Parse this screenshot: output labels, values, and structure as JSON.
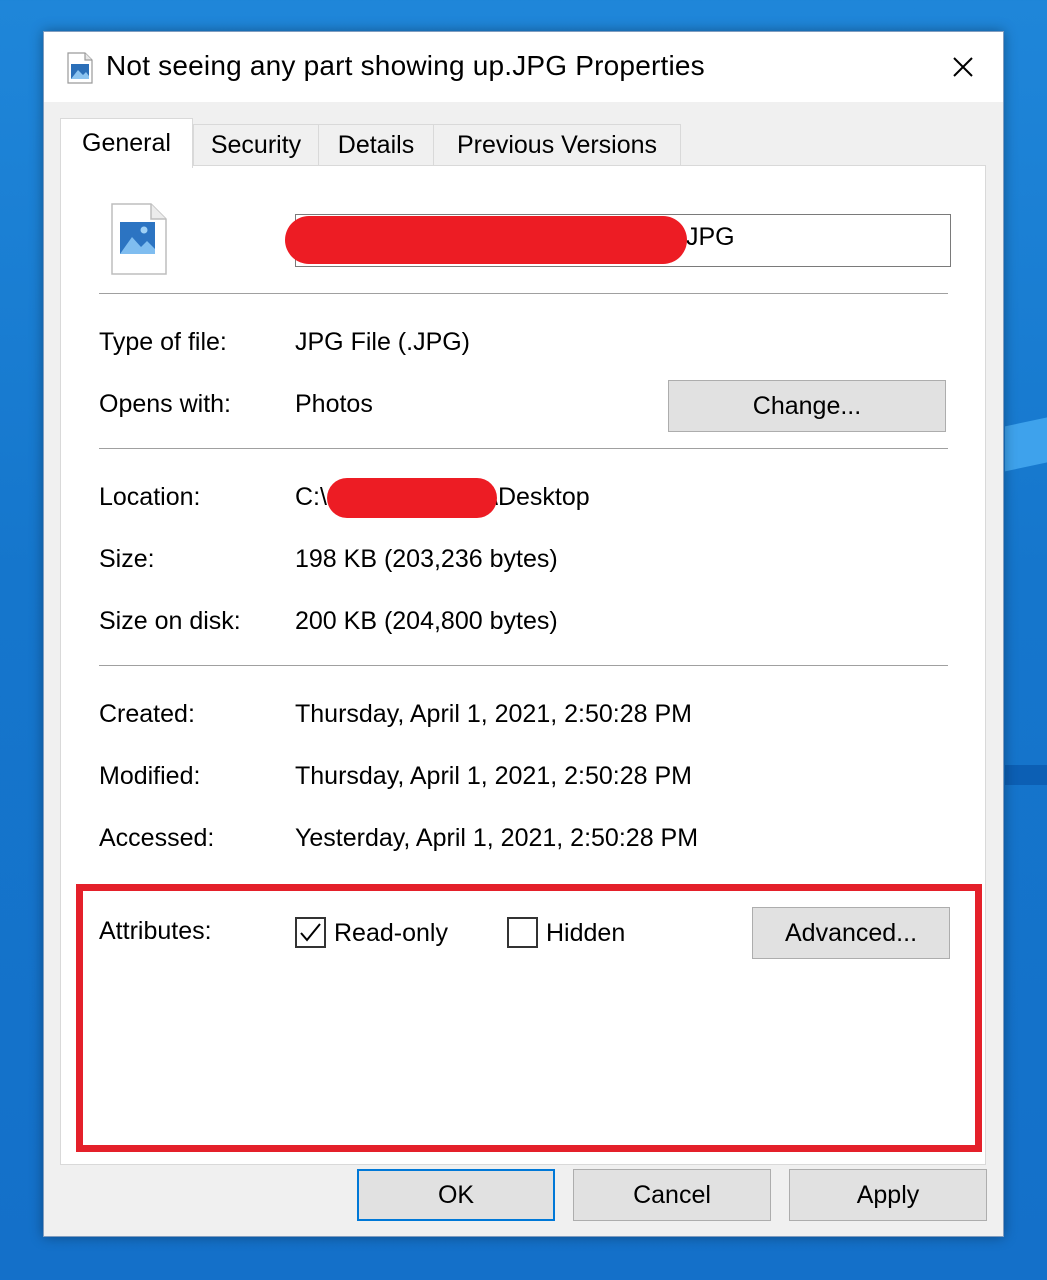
{
  "window": {
    "title": "Not seeing any part showing up.JPG Properties",
    "close_label": "×"
  },
  "tabs": [
    {
      "label": "General",
      "active": true
    },
    {
      "label": "Security",
      "active": false
    },
    {
      "label": "Details",
      "active": false
    },
    {
      "label": "Previous Versions",
      "active": false
    }
  ],
  "file": {
    "name_visible_suffix": "JPG",
    "icon": "image-file-icon"
  },
  "fields": {
    "type_label": "Type of file:",
    "type_value": "JPG File (.JPG)",
    "opens_label": "Opens with:",
    "opens_value": "Photos",
    "change_button": "Change...",
    "location_label": "Location:",
    "location_prefix": "C:\\",
    "location_suffix": "\\Desktop",
    "size_label": "Size:",
    "size_value": "198 KB (203,236 bytes)",
    "disk_label": "Size on disk:",
    "disk_value": "200 KB (204,800 bytes)",
    "created_label": "Created:",
    "created_value": "Thursday, April 1, 2021, 2:50:28 PM",
    "modified_label": "Modified:",
    "modified_value": "Thursday, April 1, 2021, 2:50:28 PM",
    "accessed_label": "Accessed:",
    "accessed_value": "Yesterday, April 1, 2021, 2:50:28 PM"
  },
  "attributes": {
    "label": "Attributes:",
    "readonly_label": "Read-only",
    "readonly_checked": true,
    "hidden_label": "Hidden",
    "hidden_checked": false,
    "advanced_button": "Advanced..."
  },
  "footer": {
    "ok": "OK",
    "cancel": "Cancel",
    "apply": "Apply"
  },
  "colors": {
    "desktop": "#1576cc",
    "highlight_border": "#e4202a",
    "redaction": "#ed1c24",
    "default_button_border": "#0078d7"
  }
}
